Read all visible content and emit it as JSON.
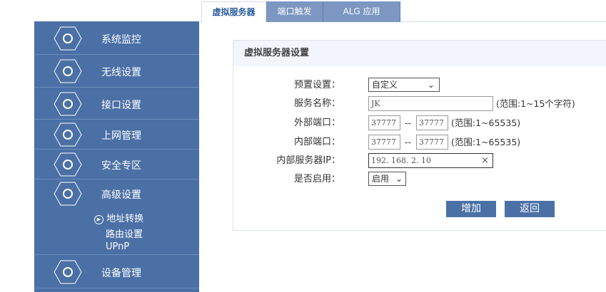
{
  "tabs": [
    {
      "label": "虚拟服务器",
      "active": true
    },
    {
      "label": "端口触发"
    },
    {
      "label": "ALG 应用"
    }
  ],
  "sidebar": {
    "items": [
      {
        "label": "系统监控",
        "icon": "monitor-gear-icon"
      },
      {
        "label": "无线设置",
        "icon": "wifi-gear-icon"
      },
      {
        "label": "接口设置",
        "icon": "interface-gear-icon"
      },
      {
        "label": "上网管理",
        "icon": "globe-icon"
      },
      {
        "label": "安全专区",
        "icon": "shield-lock-icon"
      },
      {
        "label": "高级设置",
        "icon": "gear-icon"
      },
      {
        "label": "设备管理",
        "icon": "device-manage-icon"
      }
    ],
    "submenu": [
      {
        "label": "地址转换",
        "active": true
      },
      {
        "label": "路由设置"
      },
      {
        "label": "UPnP"
      }
    ]
  },
  "panel": {
    "title": "虚拟服务器设置",
    "preset": {
      "label": "预置设置：",
      "value": "自定义"
    },
    "name": {
      "label": "服务名称：",
      "value": "JK",
      "hint": "(范围:1~15个字符)"
    },
    "ext_port": {
      "label": "外部端口：",
      "from": "37777",
      "sep": "--",
      "to": "37777",
      "hint": "(范围:1~65535)"
    },
    "int_port": {
      "label": "内部端口：",
      "from": "37777",
      "sep": "--",
      "to": "37777",
      "hint": "(范围:1~65535)"
    },
    "ip": {
      "label": "内部服务器IP：",
      "value": "192. 168. 2. 10",
      "clear": "×"
    },
    "enable": {
      "label": "是否启用：",
      "value": "启用"
    },
    "add_label": "增加",
    "back_label": "返回"
  }
}
